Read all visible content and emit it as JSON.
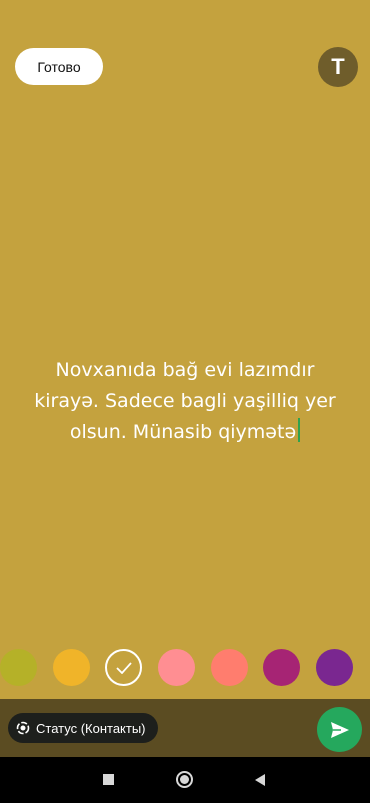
{
  "header": {
    "done_label": "Готово",
    "font_button_label": "T"
  },
  "composer": {
    "text_lines": [
      "Novxanıda bağ evi lazımdır",
      "kirayə. Sadece bagli yaşilliq yer",
      "olsun. Münasib qiymətə"
    ],
    "background_color": "#c4a23e"
  },
  "palette": {
    "colors": [
      {
        "color": "#b5b128",
        "selected": false
      },
      {
        "color": "#f0b429",
        "selected": false
      },
      {
        "color": "#c4a23e",
        "selected": true
      },
      {
        "color": "#ff8e92",
        "selected": false
      },
      {
        "color": "#ff7d6e",
        "selected": false
      },
      {
        "color": "#a62474",
        "selected": false
      },
      {
        "color": "#7a2790",
        "selected": false
      }
    ]
  },
  "footer": {
    "audience_label": "Статус (Контакты)",
    "audience_icon": "status-ring-icon",
    "send_icon": "send-arrow-icon",
    "send_color": "#25a85d"
  },
  "system_nav": {
    "icons": [
      "recents-square-icon",
      "home-circle-icon",
      "back-triangle-icon"
    ]
  }
}
